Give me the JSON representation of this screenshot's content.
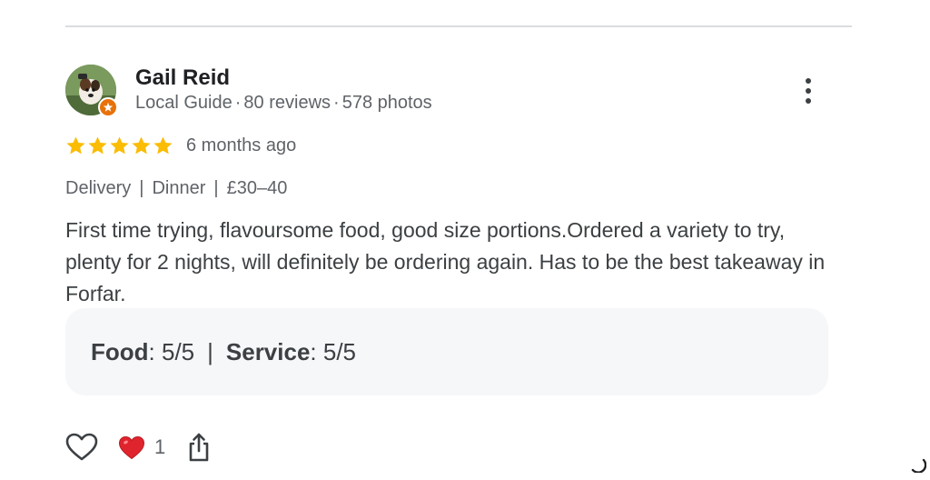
{
  "reviewer": {
    "name": "Gail Reid",
    "badge": "Local Guide",
    "reviews": "80 reviews",
    "photos": "578 photos",
    "separator": "·"
  },
  "rating": {
    "stars": 5,
    "max_stars": 5,
    "date": "6 months ago",
    "star_color": "#fbbc04"
  },
  "attributes": [
    "Delivery",
    "Dinner",
    "£30–40"
  ],
  "attribute_separator": "|",
  "review_text": "First time trying, flavoursome food, good size portions.Ordered a variety to try, plenty for 2 nights, will definitely be ordering again. Has to be the best takeaway in Forfar.",
  "sub_ratings": {
    "food_label": "Food",
    "food_value": ": 5/5",
    "separator": "|",
    "service_label": "Service",
    "service_value": ": 5/5"
  },
  "actions": {
    "like_icon": "heart-outline-icon",
    "reaction_icon": "red-heart-icon",
    "reaction_count": "1",
    "share_icon": "share-icon"
  },
  "colors": {
    "guide_badge": "#e8710a",
    "reaction_heart": "#e0242e",
    "box_background": "#f6f7f9"
  }
}
